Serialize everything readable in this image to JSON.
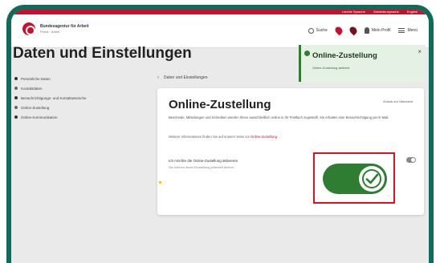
{
  "topbar": {
    "links": [
      "Leichte Sprache",
      "Gebärdensprache",
      "English"
    ]
  },
  "header": {
    "logo_title": "Bundesagentur für Arbeit",
    "logo_subtitle": "Portal · Arbeit",
    "nav": {
      "search_label": "Suche",
      "profile_label": "Mein Profil",
      "menu_label": "Menü"
    }
  },
  "page": {
    "title": "Daten und Einstellungen"
  },
  "sidebar": {
    "items": [
      {
        "label": "Persönliche Daten"
      },
      {
        "label": "Kontaktdaten"
      },
      {
        "label": "Benachrichtigungs- und Kontaktwünsche"
      },
      {
        "label": "Online-Zustellung"
      },
      {
        "label": "Online-Kommunikation"
      }
    ]
  },
  "breadcrumb": {
    "label": "Daten und Einstellungen"
  },
  "card": {
    "title": "Online-Zustellung",
    "right_link": "Zurück zur Übersicht",
    "description": "Bescheide, Mitteilungen und Schreiben werden Ihnen ausschließlich online in Ihr Postfach zugestellt. Sie erhalten eine Benachrichtigung per E-Mail.",
    "note_prefix": "Weitere Informationen finden Sie auf unserer Seite zur",
    "note_link": "Online-Zustellung",
    "setting_label": "Ich möchte die Online-Zustellung aktivieren",
    "setting_sub": "Sie können diese Einstellung jederzeit ändern."
  },
  "toggle": {
    "state": "on",
    "color": "#2e7d32"
  },
  "toast": {
    "title": "Online-Zustellung",
    "text": "Online-Zustellung aktiviert",
    "close_glyph": "×"
  },
  "colors": {
    "frame": "#0f6b5a",
    "brand_red": "#c8102e",
    "highlight_border": "#e0121f"
  }
}
